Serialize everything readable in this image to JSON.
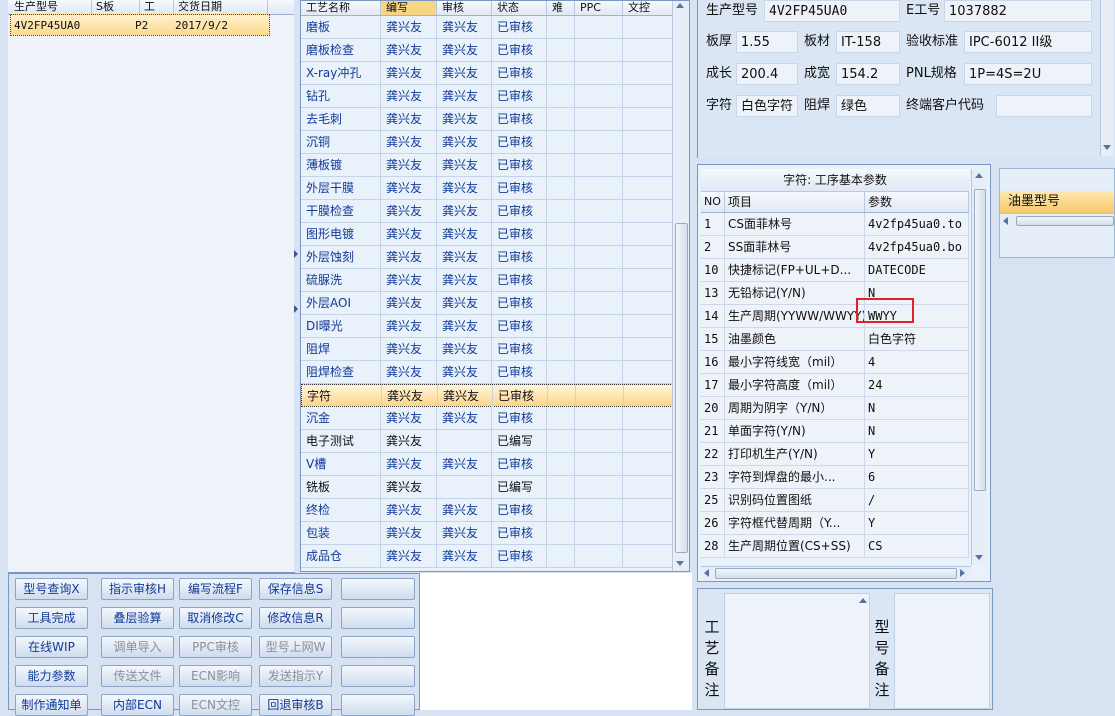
{
  "orders": {
    "headers": [
      "生产型号",
      "S板",
      "工",
      "交货日期"
    ],
    "rows": [
      {
        "model": "4V2FP45UA0",
        "stage": "P2",
        "date": "2017/9/2"
      }
    ]
  },
  "process": {
    "headers": [
      "工艺名称",
      "编写",
      "审核",
      "状态",
      "难",
      "PPC",
      "文控"
    ],
    "rows": [
      {
        "name": "磨板",
        "writer": "龚兴友",
        "reviewer": "龚兴友",
        "status": "已审核"
      },
      {
        "name": "磨板检查",
        "writer": "龚兴友",
        "reviewer": "龚兴友",
        "status": "已审核"
      },
      {
        "name": "X-ray冲孔",
        "writer": "龚兴友",
        "reviewer": "龚兴友",
        "status": "已审核"
      },
      {
        "name": "钻孔",
        "writer": "龚兴友",
        "reviewer": "龚兴友",
        "status": "已审核"
      },
      {
        "name": "去毛刺",
        "writer": "龚兴友",
        "reviewer": "龚兴友",
        "status": "已审核"
      },
      {
        "name": "沉铜",
        "writer": "龚兴友",
        "reviewer": "龚兴友",
        "status": "已审核"
      },
      {
        "name": "薄板镀",
        "writer": "龚兴友",
        "reviewer": "龚兴友",
        "status": "已审核"
      },
      {
        "name": "外层干膜",
        "writer": "龚兴友",
        "reviewer": "龚兴友",
        "status": "已审核"
      },
      {
        "name": "干膜检查",
        "writer": "龚兴友",
        "reviewer": "龚兴友",
        "status": "已审核"
      },
      {
        "name": "图形电镀",
        "writer": "龚兴友",
        "reviewer": "龚兴友",
        "status": "已审核"
      },
      {
        "name": "外层蚀刻",
        "writer": "龚兴友",
        "reviewer": "龚兴友",
        "status": "已审核"
      },
      {
        "name": "硫脲洗",
        "writer": "龚兴友",
        "reviewer": "龚兴友",
        "status": "已审核"
      },
      {
        "name": "外层AOI",
        "writer": "龚兴友",
        "reviewer": "龚兴友",
        "status": "已审核"
      },
      {
        "name": "DI曝光",
        "writer": "龚兴友",
        "reviewer": "龚兴友",
        "status": "已审核"
      },
      {
        "name": "阻焊",
        "writer": "龚兴友",
        "reviewer": "龚兴友",
        "status": "已审核"
      },
      {
        "name": "阻焊检查",
        "writer": "龚兴友",
        "reviewer": "龚兴友",
        "status": "已审核"
      },
      {
        "name": "字符",
        "writer": "龚兴友",
        "reviewer": "龚兴友",
        "status": "已审核",
        "selected": true
      },
      {
        "name": "沉金",
        "writer": "龚兴友",
        "reviewer": "龚兴友",
        "status": "已审核"
      },
      {
        "name": "电子测试",
        "writer": "龚兴友",
        "reviewer": "",
        "status": "已编写",
        "gray": true
      },
      {
        "name": "V槽",
        "writer": "龚兴友",
        "reviewer": "龚兴友",
        "status": "已审核"
      },
      {
        "name": "铣板",
        "writer": "龚兴友",
        "reviewer": "",
        "status": "已编写",
        "gray": true
      },
      {
        "name": "终检",
        "writer": "龚兴友",
        "reviewer": "龚兴友",
        "status": "已审核"
      },
      {
        "name": "包装",
        "writer": "龚兴友",
        "reviewer": "龚兴友",
        "status": "已审核"
      },
      {
        "name": "成品仓",
        "writer": "龚兴友",
        "reviewer": "龚兴友",
        "status": "已审核"
      }
    ]
  },
  "buttons": [
    [
      {
        "label": "型号查询X",
        "enabled": true
      },
      {
        "label": "指示审核H",
        "enabled": true
      },
      {
        "label": "编写流程F",
        "enabled": true
      },
      {
        "label": "保存信息S",
        "enabled": true
      },
      {
        "label": "",
        "enabled": true
      }
    ],
    [
      {
        "label": "工具完成",
        "enabled": true
      },
      {
        "label": "叠层验算",
        "enabled": true
      },
      {
        "label": "取消修改C",
        "enabled": true
      },
      {
        "label": "修改信息R",
        "enabled": true
      },
      {
        "label": "",
        "enabled": true
      }
    ],
    [
      {
        "label": "在线WIP",
        "enabled": true
      },
      {
        "label": "调单导入",
        "enabled": false
      },
      {
        "label": "PPC审核",
        "enabled": false
      },
      {
        "label": "型号上网W",
        "enabled": false
      },
      {
        "label": "",
        "enabled": true
      }
    ],
    [
      {
        "label": "能力参数",
        "enabled": true
      },
      {
        "label": "传送文件",
        "enabled": false
      },
      {
        "label": "ECN影响",
        "enabled": false
      },
      {
        "label": "发送指示Y",
        "enabled": false
      },
      {
        "label": "",
        "enabled": true
      }
    ],
    [
      {
        "label": "制作通知单",
        "enabled": true
      },
      {
        "label": "内部ECN",
        "enabled": true
      },
      {
        "label": "ECN文控",
        "enabled": false
      },
      {
        "label": "回退审核B",
        "enabled": true
      },
      {
        "label": "",
        "enabled": true
      }
    ]
  ],
  "info": {
    "model_label": "生产型号",
    "model_value": "4V2FP45UA0",
    "e_label": "E工号",
    "e_value": "1037882",
    "thickness_label": "板厚",
    "thickness_value": "1.55",
    "material_label": "板材",
    "material_value": "IT-158",
    "standard_label": "验收标准",
    "standard_value": "IPC-6012 II级",
    "grow_label": "成长",
    "grow_value": "200.4",
    "width_label": "成宽",
    "width_value": "154.2",
    "pnl_label": "PNL规格",
    "pnl_value": "1P=4S=2U",
    "char_label": "字符",
    "char_value": "白色字符",
    "mask_label": "阻焊",
    "mask_value": "绿色",
    "customer_label": "终端客户代码",
    "customer_value": ""
  },
  "params": {
    "title": "字符: 工序基本参数",
    "headers": [
      "NO",
      "项目",
      "参数"
    ],
    "rows": [
      {
        "no": "1",
        "item": "CS面菲林号",
        "value": "4v2fp45ua0.to"
      },
      {
        "no": "2",
        "item": "SS面菲林号",
        "value": "4v2fp45ua0.bo"
      },
      {
        "no": "10",
        "item": "快捷标记(FP+UL+D...",
        "value": "DATECODE"
      },
      {
        "no": "13",
        "item": "无铅标记(Y/N)",
        "value": "N"
      },
      {
        "no": "14",
        "item": "生产周期(YYWW/WWYY)",
        "value": "WWYY",
        "highlight": true
      },
      {
        "no": "15",
        "item": "油墨颜色",
        "value": "白色字符"
      },
      {
        "no": "16",
        "item": "最小字符线宽（mil）",
        "value": "4"
      },
      {
        "no": "17",
        "item": "最小字符高度（mil）",
        "value": "24"
      },
      {
        "no": "20",
        "item": "周期为阴字（Y/N）",
        "value": "N"
      },
      {
        "no": "21",
        "item": "单面字符(Y/N)",
        "value": "N"
      },
      {
        "no": "22",
        "item": "打印机生产(Y/N)",
        "value": "Y"
      },
      {
        "no": "23",
        "item": "字符到焊盘的最小...",
        "value": "6"
      },
      {
        "no": "25",
        "item": "识别码位置图纸",
        "value": "/"
      },
      {
        "no": "26",
        "item": "字符框代替周期（Y...",
        "value": "Y"
      },
      {
        "no": "28",
        "item": "生产周期位置(CS+SS)",
        "value": "CS"
      }
    ]
  },
  "ink": {
    "header": "油墨型号"
  },
  "remarks": {
    "process_label": "工艺备注",
    "model_label": "型号备注"
  },
  "colors": {
    "accent_selected": "#fbd48a",
    "text_blue": "#123a96",
    "highlight_box": "#e0202a"
  }
}
